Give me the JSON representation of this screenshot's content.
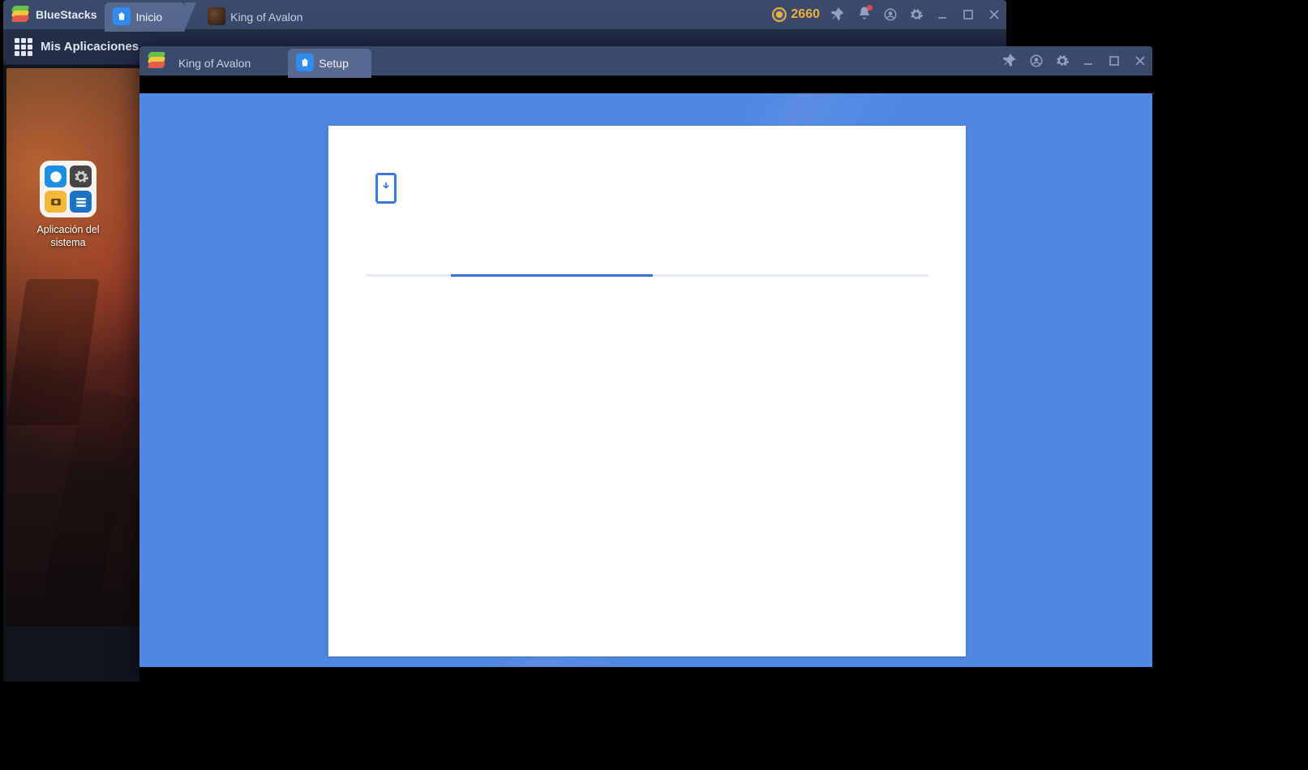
{
  "back": {
    "brand": "BlueStacks",
    "tabs": [
      {
        "label": "Inicio",
        "icon": "bag",
        "active": true
      },
      {
        "label": "King of Avalon",
        "icon": "game",
        "active": false
      }
    ],
    "coins": "2660",
    "toolbar_label": "Mis Aplicaciones",
    "system_app_label": "Aplicación del sistema"
  },
  "front": {
    "tabs": [
      {
        "label": "King of Avalon",
        "icon": "logo",
        "active": false
      },
      {
        "label": "Setup",
        "icon": "bag",
        "active": true
      }
    ],
    "progress": {
      "start_pct": 15,
      "end_pct": 51
    }
  },
  "colors": {
    "titlebar": "#3a4a6b",
    "tab_active": "#58698f",
    "canvas_blue": "#4f87e2",
    "progress_blue": "#3b72d8",
    "coin": "#f0b03a"
  }
}
